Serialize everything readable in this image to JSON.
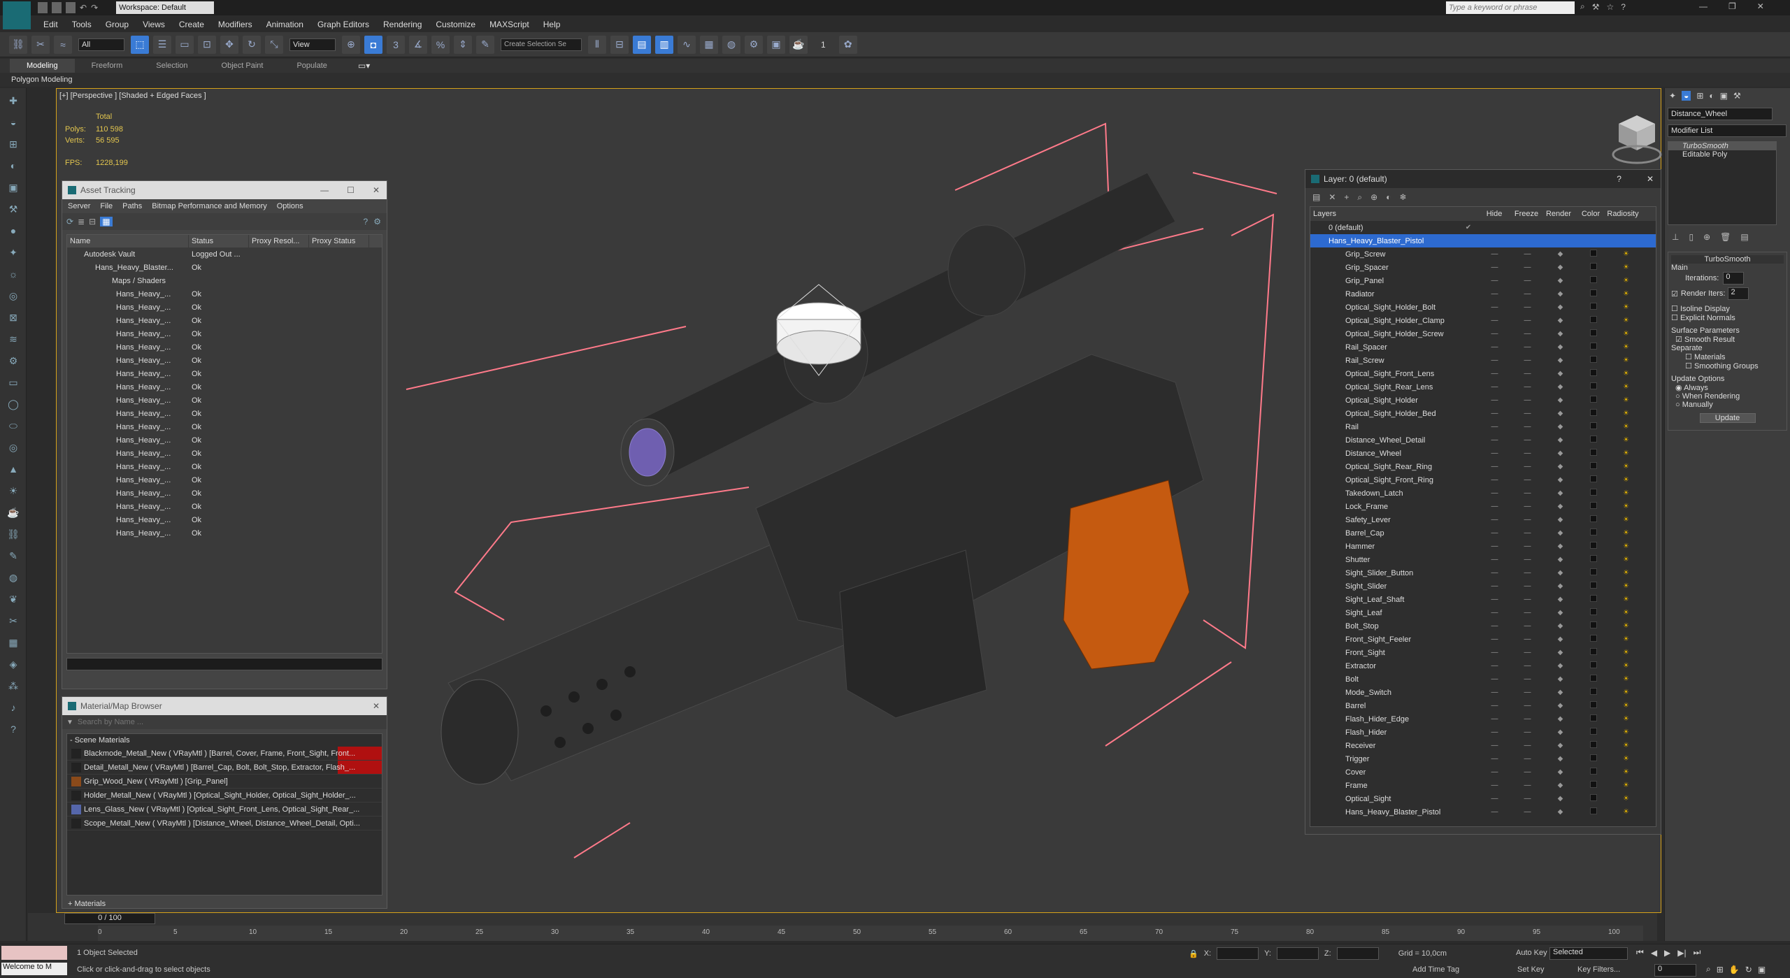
{
  "titlebar": {
    "workspace": "Workspace: Default",
    "search_placeholder": "Type a keyword or phrase"
  },
  "menu": [
    "Edit",
    "Tools",
    "Group",
    "Views",
    "Create",
    "Modifiers",
    "Animation",
    "Graph Editors",
    "Rendering",
    "Customize",
    "MAXScript",
    "Help"
  ],
  "toolbar": {
    "filter": "All",
    "view": "View",
    "selection_set": "Create Selection Se",
    "count": "1"
  },
  "ribbon": {
    "tabs": [
      "Modeling",
      "Freeform",
      "Selection",
      "Object Paint",
      "Populate"
    ],
    "sub": "Polygon Modeling"
  },
  "viewport": {
    "label": "[+] [Perspective ] [Shaded + Edged Faces ]",
    "stats_header": "Total",
    "polys_label": "Polys:",
    "polys": "110 598",
    "verts_label": "Verts:",
    "verts": "56 595",
    "fps_label": "FPS:",
    "fps": "1228,199"
  },
  "asset_tracking": {
    "title": "Asset Tracking",
    "menus": [
      "Server",
      "File",
      "Paths",
      "Bitmap Performance and Memory",
      "Options"
    ],
    "columns": [
      "Name",
      "Status",
      "Proxy Resol...",
      "Proxy Status"
    ],
    "rows": [
      {
        "name": "Autodesk Vault",
        "status": "Logged Out ..."
      },
      {
        "name": "Hans_Heavy_Blaster...",
        "status": "Ok"
      },
      {
        "name": "Maps / Shaders",
        "status": ""
      },
      {
        "name": "Hans_Heavy_...",
        "status": "Ok"
      },
      {
        "name": "Hans_Heavy_...",
        "status": "Ok"
      },
      {
        "name": "Hans_Heavy_...",
        "status": "Ok"
      },
      {
        "name": "Hans_Heavy_...",
        "status": "Ok"
      },
      {
        "name": "Hans_Heavy_...",
        "status": "Ok"
      },
      {
        "name": "Hans_Heavy_...",
        "status": "Ok"
      },
      {
        "name": "Hans_Heavy_...",
        "status": "Ok"
      },
      {
        "name": "Hans_Heavy_...",
        "status": "Ok"
      },
      {
        "name": "Hans_Heavy_...",
        "status": "Ok"
      },
      {
        "name": "Hans_Heavy_...",
        "status": "Ok"
      },
      {
        "name": "Hans_Heavy_...",
        "status": "Ok"
      },
      {
        "name": "Hans_Heavy_...",
        "status": "Ok"
      },
      {
        "name": "Hans_Heavy_...",
        "status": "Ok"
      },
      {
        "name": "Hans_Heavy_...",
        "status": "Ok"
      },
      {
        "name": "Hans_Heavy_...",
        "status": "Ok"
      },
      {
        "name": "Hans_Heavy_...",
        "status": "Ok"
      },
      {
        "name": "Hans_Heavy_...",
        "status": "Ok"
      },
      {
        "name": "Hans_Heavy_...",
        "status": "Ok"
      },
      {
        "name": "Hans_Heavy_...",
        "status": "Ok"
      }
    ]
  },
  "material_browser": {
    "title": "Material/Map Browser",
    "search_placeholder": "Search by Name ...",
    "group": "- Scene Materials",
    "items": [
      "Blackmode_Metall_New ( VRayMtl ) [Barrel, Cover, Frame, Front_Sight, Front...",
      "Detail_Metall_New ( VRayMtl ) [Barrel_Cap, Bolt, Bolt_Stop, Extractor, Flash_...",
      "Grip_Wood_New ( VRayMtl ) [Grip_Panel]",
      "Holder_Metall_New ( VRayMtl ) [Optical_Sight_Holder, Optical_Sight_Holder_...",
      "Lens_Glass_New ( VRayMtl ) [Optical_Sight_Front_Lens, Optical_Sight_Rear_...",
      "Scope_Metall_New ( VRayMtl ) [Distance_Wheel, Distance_Wheel_Detail, Opti..."
    ],
    "footer": "+ Materials"
  },
  "layer_dialog": {
    "title": "Layer: 0 (default)",
    "columns": [
      "Layers",
      "Hide",
      "Freeze",
      "Render",
      "Color",
      "Radiosity"
    ],
    "default_layer": "0 (default)",
    "selected_layer": "Hans_Heavy_Blaster_Pistol",
    "objects": [
      "Grip_Screw",
      "Grip_Spacer",
      "Grip_Panel",
      "Radiator",
      "Optical_Sight_Holder_Bolt",
      "Optical_Sight_Holder_Clamp",
      "Optical_Sight_Holder_Screw",
      "Rail_Spacer",
      "Rail_Screw",
      "Optical_Sight_Front_Lens",
      "Optical_Sight_Rear_Lens",
      "Optical_Sight_Holder",
      "Optical_Sight_Holder_Bed",
      "Rail",
      "Distance_Wheel_Detail",
      "Distance_Wheel",
      "Optical_Sight_Rear_Ring",
      "Optical_Sight_Front_Ring",
      "Takedown_Latch",
      "Lock_Frame",
      "Safety_Lever",
      "Barrel_Cap",
      "Hammer",
      "Shutter",
      "Sight_Slider_Button",
      "Sight_Slider",
      "Sight_Leaf_Shaft",
      "Sight_Leaf",
      "Bolt_Stop",
      "Front_Sight_Feeler",
      "Front_Sight",
      "Extractor",
      "Bolt",
      "Mode_Switch",
      "Barrel",
      "Flash_Hider_Edge",
      "Flash_Hider",
      "Receiver",
      "Trigger",
      "Cover",
      "Frame",
      "Optical_Sight",
      "Hans_Heavy_Blaster_Pistol"
    ]
  },
  "command_panel": {
    "object_name": "Distance_Wheel",
    "modifier_list": "Modifier List",
    "stack": [
      "TurboSmooth",
      "Editable Poly"
    ],
    "rollout_title": "TurboSmooth",
    "main": "Main",
    "iterations_label": "Iterations:",
    "iterations": "0",
    "render_iters_label": "Render Iters:",
    "render_iters": "2",
    "isoline": "Isoline Display",
    "explicit": "Explicit Normals",
    "surface": "Surface Parameters",
    "smooth_result": "Smooth Result",
    "separate": "Separate",
    "materials": "Materials",
    "smoothing": "Smoothing Groups",
    "update_options": "Update Options",
    "always": "Always",
    "when_rendering": "When Rendering",
    "manually": "Manually",
    "update_button": "Update"
  },
  "timeline": {
    "frame": "0 / 100",
    "ticks": [
      "0",
      "5",
      "10",
      "15",
      "20",
      "25",
      "30",
      "35",
      "40",
      "45",
      "50",
      "55",
      "60",
      "65",
      "70",
      "75",
      "80",
      "85",
      "90",
      "95",
      "100"
    ]
  },
  "status": {
    "selected": "1 Object Selected",
    "prompt": "Click or click-and-drag to select objects",
    "welcome": "Welcome to M",
    "x": "X:",
    "y": "Y:",
    "z": "Z:",
    "grid": "Grid = 10,0cm",
    "add_time_tag": "Add Time Tag",
    "auto_key": "Auto Key",
    "selected_dd": "Selected",
    "set_key": "Set Key",
    "key_filters": "Key Filters...",
    "frame": "0"
  },
  "colors": {
    "accent": "#3a7bd5",
    "viewport_border": "#d6a21a",
    "stat_yellow": "#e3c64f",
    "grip_orange": "#c55a10"
  }
}
